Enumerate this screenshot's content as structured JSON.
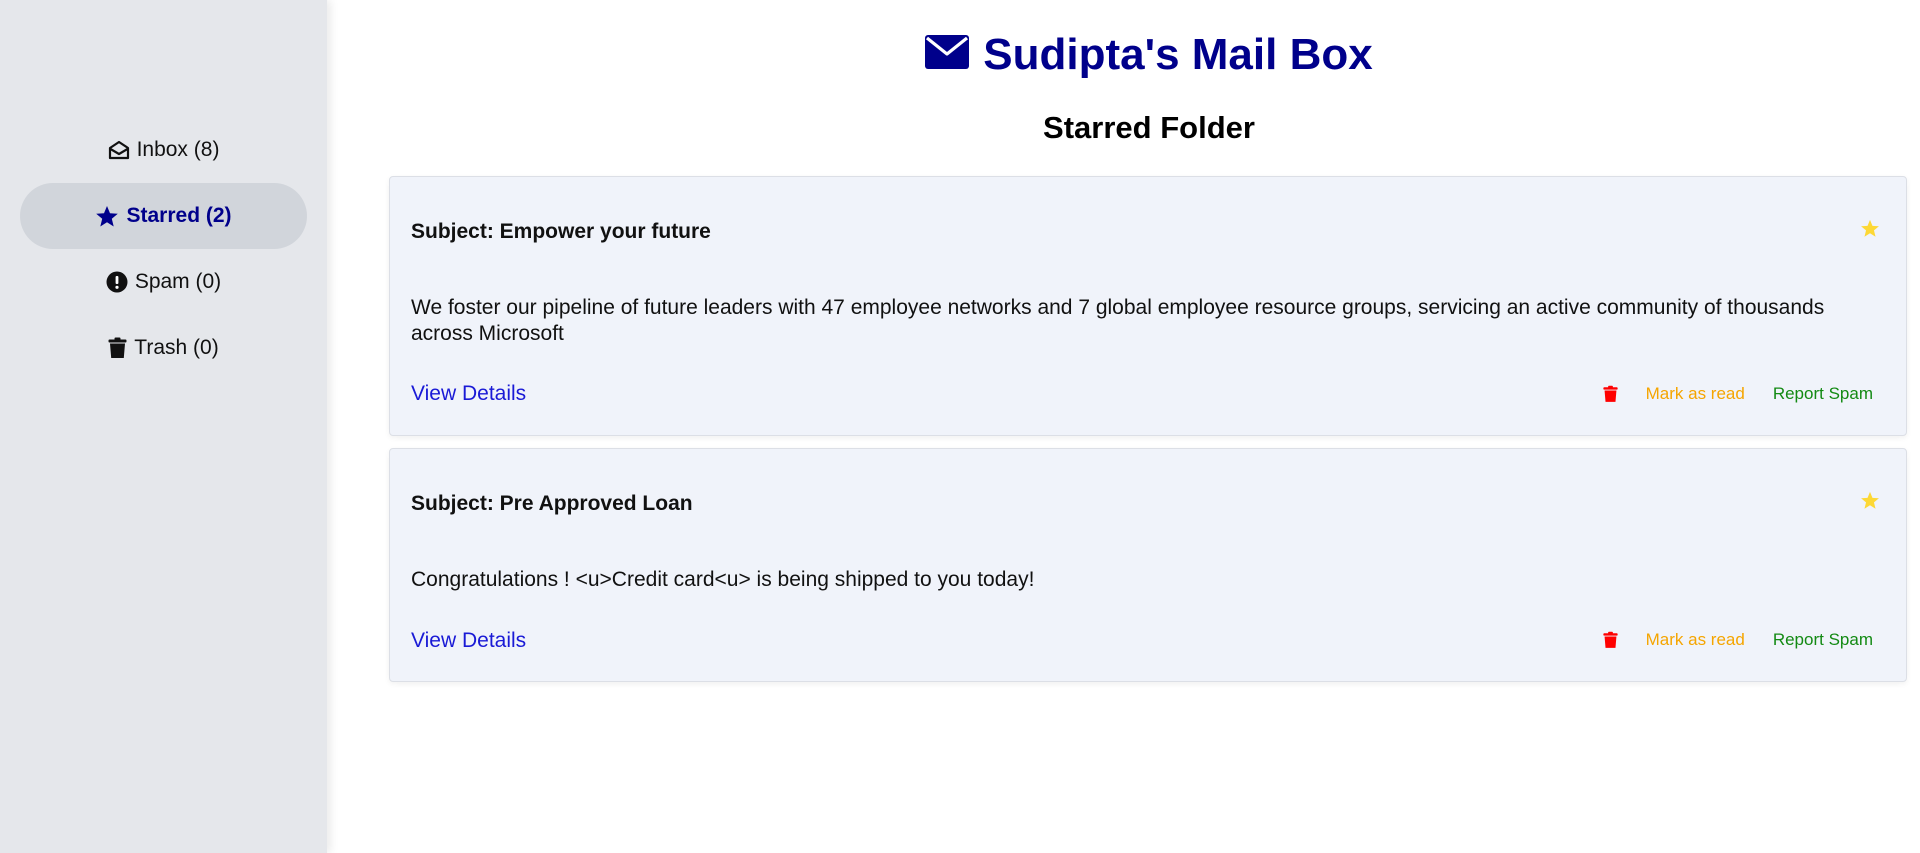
{
  "header": {
    "title": "Sudipta's Mail Box",
    "title_icon": "envelope-icon",
    "title_color": "#00008b"
  },
  "sidebar": {
    "items": [
      {
        "label": "Inbox (8)",
        "icon": "envelope-open-icon",
        "active": false
      },
      {
        "label": "Starred (2)",
        "icon": "star-icon",
        "active": true
      },
      {
        "label": "Spam (0)",
        "icon": "exclamation-circle-icon",
        "active": false
      },
      {
        "label": "Trash (0)",
        "icon": "trash-icon",
        "active": false
      }
    ]
  },
  "folder": {
    "title": "Starred Folder"
  },
  "emails": [
    {
      "subject": "Subject: Empower your future",
      "body": "We foster our pipeline of future leaders with 47 employee networks and 7 global employee resource groups, servicing an active community of thousands across Microsoft",
      "view_label": "View Details",
      "mark_read_label": "Mark as read",
      "report_spam_label": "Report Spam",
      "starred": true
    },
    {
      "subject": "Subject: Pre Approved Loan",
      "body": "Congratulations ! <u>Credit card<u> is being shipped to you today!",
      "view_label": "View Details",
      "mark_read_label": "Mark as read",
      "report_spam_label": "Report Spam",
      "starred": true
    }
  ],
  "colors": {
    "accent": "#00008b",
    "star": "#fdd835",
    "trash": "#ff0000",
    "mark_read": "#f5a500",
    "report_spam": "#138a13",
    "link": "#1a1ad6"
  }
}
